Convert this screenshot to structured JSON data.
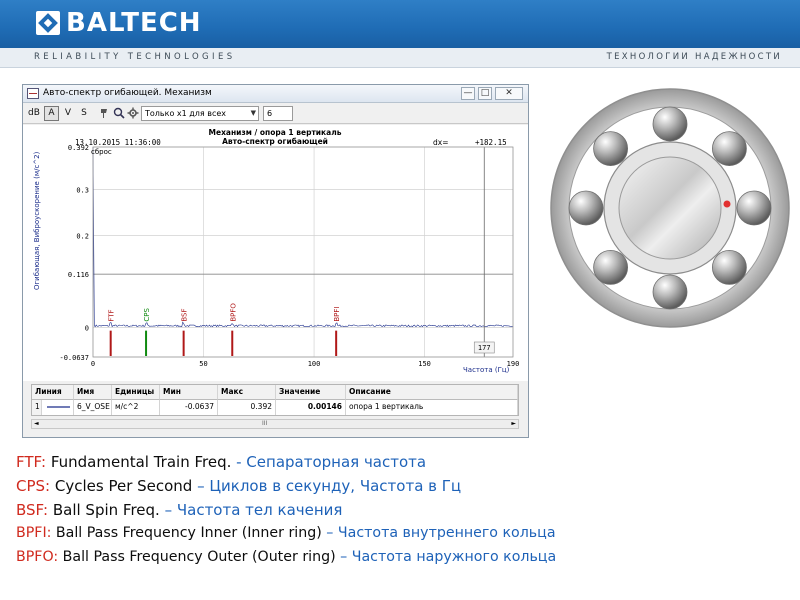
{
  "header": {
    "brand": "BALTECH",
    "tagline_left": "RELIABILITY TECHNOLOGIES",
    "tagline_right": "ТЕХНОЛОГИИ НАДЕЖНОСТИ",
    "banner_color": "#1f6cb5"
  },
  "window": {
    "title": "Авто-спектр огибающей. Механизм",
    "controls": {
      "minimize": "—",
      "maximize": "□",
      "close": "✕"
    },
    "toolbar": {
      "db": "dB",
      "a": "A",
      "v": "V",
      "s": "S",
      "filter_select": "Только x1 для всех",
      "filter_number": "6",
      "icons": [
        "pin-icon",
        "search-icon",
        "settings-icon"
      ]
    }
  },
  "chart_data": {
    "type": "line",
    "timestamp": "13.10.2015 11:36:00",
    "title": "Механизм / опора 1 вертикаль",
    "subtitle": "Авто-спектр огибающей",
    "ylabel": "Огибающая, Виброускорение (м/с^2)",
    "xlabel": "Частота (Гц)",
    "reset_label": "сброс",
    "dx_label": "dx=",
    "dx_value": "+182.15",
    "cursor_value": "177",
    "ylim": [
      -0.0637,
      0.392
    ],
    "xlim": [
      0,
      190
    ],
    "y_ticks": [
      "0.392",
      "0.3",
      "0.2",
      "0.116",
      "0",
      "-0.0637"
    ],
    "y_tick_values": [
      0.392,
      0.3,
      0.2,
      0.116,
      0,
      -0.0637
    ],
    "x_ticks": [
      "0",
      "50",
      "100",
      "150",
      "190"
    ],
    "x_tick_values": [
      0,
      50,
      100,
      150,
      190
    ],
    "marker_level": 0.116,
    "cursor_x": 177,
    "initial_peak": {
      "x": 0,
      "y": 0.392
    },
    "markers": [
      {
        "label": "FTF",
        "x": 8,
        "color": "#b01818"
      },
      {
        "label": "CPS",
        "x": 24,
        "color": "#108a10"
      },
      {
        "label": "BSF",
        "x": 41,
        "color": "#b01818"
      },
      {
        "label": "BPFO",
        "x": 63,
        "color": "#b01818"
      },
      {
        "label": "BPFI",
        "x": 110,
        "color": "#b01818"
      }
    ],
    "series_color": "#1a2c8a",
    "grid": true
  },
  "table": {
    "headers": [
      "Линия",
      "Имя",
      "Единицы",
      "Мин",
      "Макс",
      "Значение",
      "Описание"
    ],
    "rows": [
      {
        "index": "1",
        "line": "",
        "name": "6_V_OSE",
        "units": "м/с^2",
        "min": "-0.0637",
        "max": "0.392",
        "value": "0.00146",
        "description": "опора 1 вертикаль"
      }
    ],
    "scroll_arrow": "III"
  },
  "bearing": {
    "ball_count": 8,
    "sensor_color": "#e23030"
  },
  "legend": [
    {
      "abbr": "FTF:",
      "en": " Fundamental Train Freq. ",
      "ru": "- Сепараторная частота"
    },
    {
      "abbr": "CPS:",
      "en": " Cycles Per Second ",
      "ru": "– Циклов в секунду, Частота в Гц"
    },
    {
      "abbr": "BSF:",
      "en": " Ball Spin Freq. ",
      "ru": "– Частота тел качения"
    },
    {
      "abbr": "BPFI:",
      "en": " Ball Pass Frequency Inner (Inner ring) ",
      "ru": "– Частота внутреннего кольца"
    },
    {
      "abbr": "BPFO:",
      "en": " Ball Pass Frequency Outer (Outer ring) ",
      "ru": "– Частота наружного кольца"
    }
  ]
}
